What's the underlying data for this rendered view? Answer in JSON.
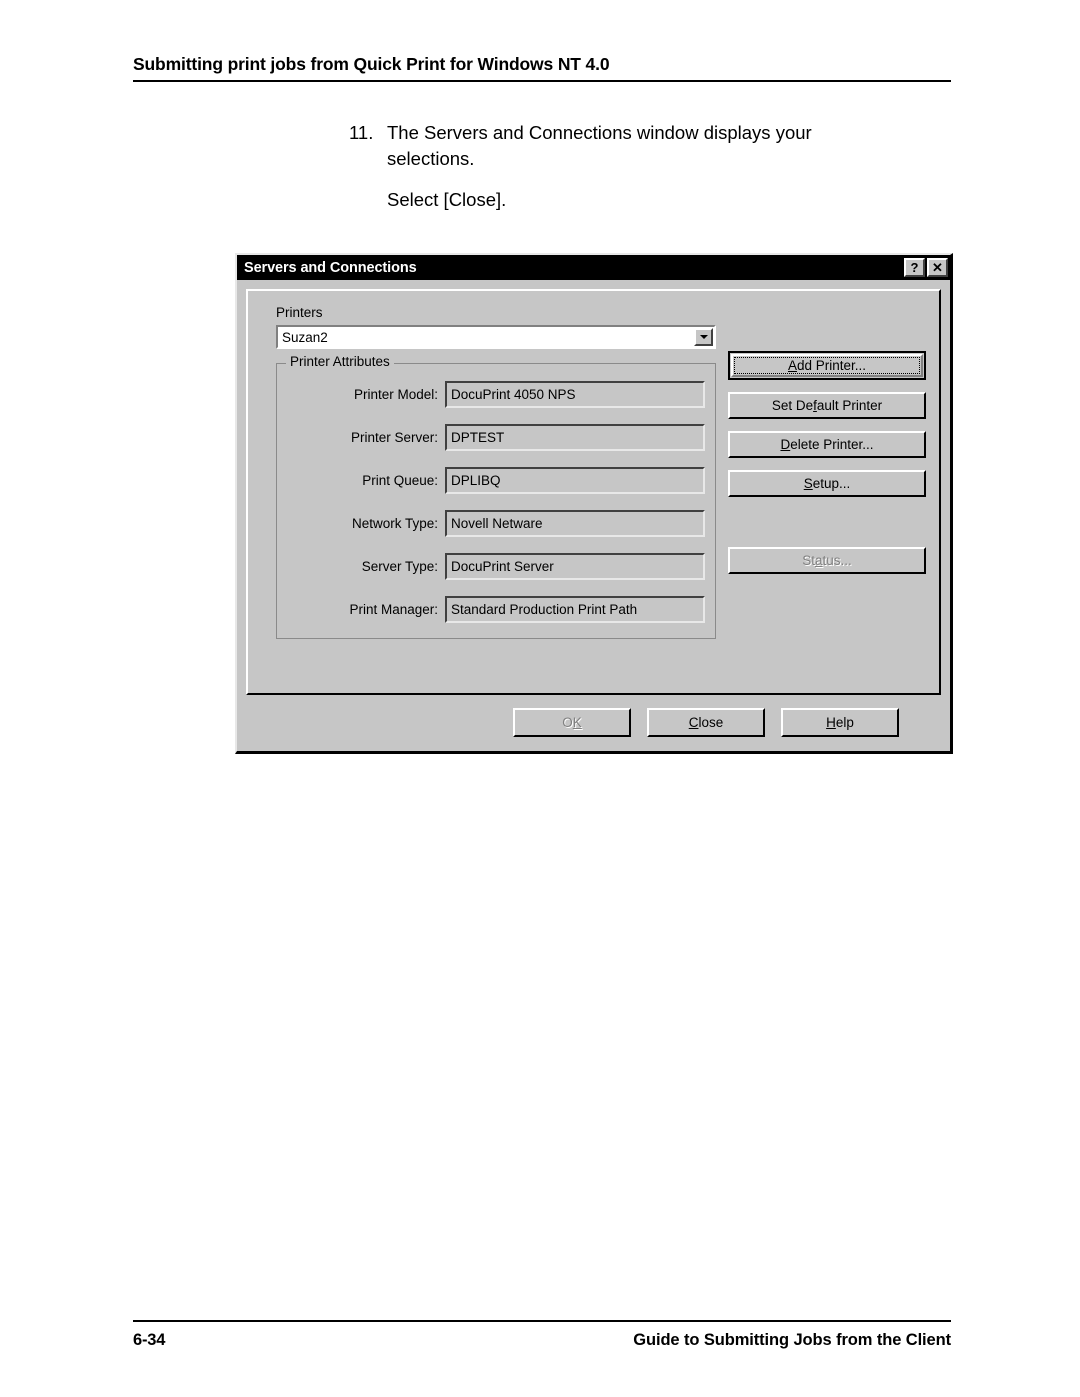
{
  "page": {
    "header_title": "Submitting print jobs from Quick Print for Windows NT 4.0",
    "page_number": "6-34",
    "footer_guide": "Guide to Submitting Jobs from the Client"
  },
  "instructions": {
    "step_number": "11.",
    "step_text": "The Servers and Connections window displays your selections.",
    "followup_text": "Select [Close]."
  },
  "dialog": {
    "title": "Servers and Connections",
    "titlebar_buttons": [
      {
        "name": "help-button",
        "glyph": "?"
      },
      {
        "name": "close-button",
        "glyph": "✕"
      }
    ],
    "printers": {
      "label": "Printers",
      "selected": "Suzan2"
    },
    "printer_attributes": {
      "legend": "Printer Attributes",
      "rows": [
        {
          "label": "Printer Model:",
          "value": "DocuPrint 4050 NPS"
        },
        {
          "label": "Printer Server:",
          "value": "DPTEST"
        },
        {
          "label": "Print Queue:",
          "value": "DPLIBQ"
        },
        {
          "label": "Network Type:",
          "value": "Novell Netware"
        },
        {
          "label": "Server Type:",
          "value": "DocuPrint Server"
        },
        {
          "label": "Print Manager:",
          "value": "Standard Production Print Path"
        }
      ]
    },
    "side_buttons": [
      {
        "pre": "",
        "acc": "A",
        "post": "dd Printer...",
        "disabled": false,
        "focused": true
      },
      {
        "pre": "Set De",
        "acc": "f",
        "post": "ault Printer",
        "disabled": false,
        "focused": false
      },
      {
        "pre": "",
        "acc": "D",
        "post": "elete Printer...",
        "disabled": false,
        "focused": false
      },
      {
        "pre": "",
        "acc": "S",
        "post": "etup...",
        "disabled": false,
        "focused": false
      },
      {
        "pre": "St",
        "acc": "a",
        "post": "tus...",
        "disabled": true,
        "focused": false
      }
    ],
    "footer_buttons": [
      {
        "pre": "O",
        "acc": "K",
        "post": "",
        "disabled": true
      },
      {
        "pre": "",
        "acc": "C",
        "post": "lose",
        "disabled": false
      },
      {
        "pre": "",
        "acc": "H",
        "post": "elp",
        "disabled": false
      }
    ]
  }
}
